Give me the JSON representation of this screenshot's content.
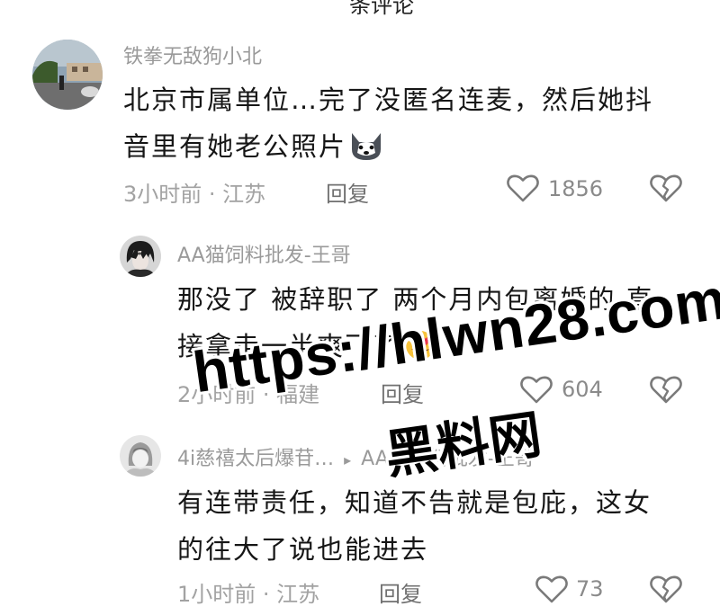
{
  "top_fragment": "条评论",
  "comments": [
    {
      "username": "铁拳无敌狗小北",
      "lines": [
        "北京市属单位…完了没匿名连麦，然后她抖",
        "音里有她老公照片"
      ],
      "emoji": "husky-emoji",
      "meta": "3小时前 · 江苏",
      "reply_label": "回复",
      "likes": "1856"
    },
    {
      "username": "AA猫饲料批发-王哥",
      "lines": [
        "那没了 被辞职了 两个月内包离婚的 直",
        "接拿走一半爽飞了"
      ],
      "emoji": "heart-eyes-emoji",
      "meta": "2小时前 · 福建",
      "reply_label": "回复",
      "likes": "604"
    },
    {
      "username": "4i慈禧太后爆苷…",
      "reply_arrow": "▸",
      "reply_to": "AA猫饲料批发-王哥",
      "lines": [
        "有连带责任，知道不告就是包庇，这女",
        "的往大了说也能进去"
      ],
      "meta": "1小时前 · 江苏",
      "reply_label": "回复",
      "likes": "73"
    }
  ],
  "watermark": {
    "url": "https://hlwn28.com",
    "name": "黑料网"
  },
  "colors": {
    "username": "#9a9a9a",
    "body": "#161616",
    "meta": "#a2a2a2",
    "icon": "#7a7a7a"
  },
  "icons": [
    "heart-outline-icon",
    "broken-heart-icon"
  ]
}
